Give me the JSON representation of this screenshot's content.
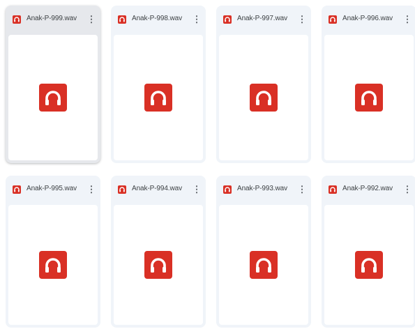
{
  "colors": {
    "accent": "#d93025",
    "card_bg": "#f0f4f9",
    "card_selected_bg": "#e6e8ec"
  },
  "files": [
    {
      "name": "Anak-P-999.wav",
      "selected": true
    },
    {
      "name": "Anak-P-998.wav"
    },
    {
      "name": "Anak-P-997.wav"
    },
    {
      "name": "Anak-P-996.wav"
    },
    {
      "name": "Anak-P-995.wav"
    },
    {
      "name": "Anak-P-994.wav"
    },
    {
      "name": "Anak-P-993.wav"
    },
    {
      "name": "Anak-P-992.wav"
    }
  ],
  "menu_glyph": "⋮",
  "file_icon": "headphones-icon"
}
